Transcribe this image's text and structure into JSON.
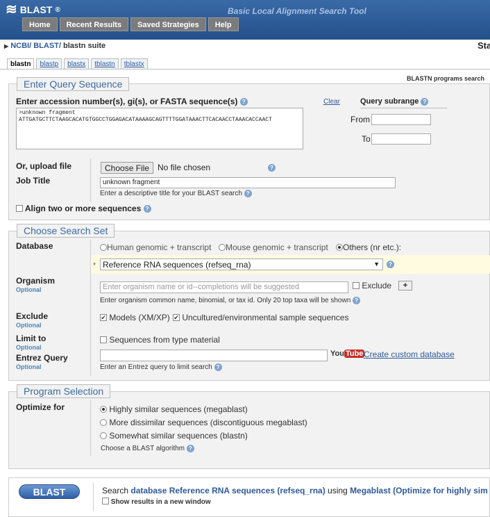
{
  "header": {
    "logo": "BLAST",
    "reg": "®",
    "tool_name": "Basic Local Alignment Search Tool",
    "nav": [
      "Home",
      "Recent Results",
      "Saved Strategies",
      "Help"
    ]
  },
  "breadcrumb": {
    "ncbi": "NCBI/",
    "blast": "BLAST/",
    "current": "blastn suite",
    "right": "Sta"
  },
  "tabs": [
    "blastn",
    "blastp",
    "blastx",
    "tblastn",
    "tblastx"
  ],
  "programs_search": "BLASTN programs search",
  "query": {
    "legend": "Enter Query Sequence",
    "accession_label": "Enter accession number(s), gi(s), or FASTA sequence(s)",
    "clear": "Clear",
    "subrange_title": "Query subrange",
    "from": "From",
    "to": "To",
    "seq_line1": ">unknown fragment",
    "seq_line2": "ATTGATGCTTCTAAGCACATGTGGCCTGGAGACATAAAAGCAGTTTTGGATAAACTTCACAACCTAAACACCAACT",
    "upload_label": "Or, upload file",
    "choose_file": "Choose File",
    "no_file": "No file chosen",
    "job_title_label": "Job Title",
    "job_title_value": "unknown fragment",
    "job_hint": "Enter a descriptive title for your BLAST search",
    "align_two": "Align two or more sequences"
  },
  "search_set": {
    "legend": "Choose Search Set",
    "database_label": "Database",
    "db_options": [
      "Human genomic + transcript",
      "Mouse genomic + transcript",
      "Others (nr etc.):"
    ],
    "db_selected": "Reference RNA sequences (refseq_rna)",
    "organism_label": "Organism",
    "optional": "Optional",
    "organism_placeholder": "Enter organism name or id--completions will be suggested",
    "exclude": "Exclude",
    "plus": "+",
    "organism_hint": "Enter organism common name, binomial, or tax id. Only 20 top taxa will be shown",
    "exclude_label": "Exclude",
    "models": "Models (XM/XP)",
    "uncultured": "Uncultured/environmental sample sequences",
    "limit_label": "Limit to",
    "type_material": "Sequences from type material",
    "entrez_label": "Entrez Query",
    "youtube": "YouTube",
    "custom_db": "Create custom database",
    "entrez_hint": "Enter an Entrez query to limit search"
  },
  "program": {
    "legend": "Program Selection",
    "optimize_label": "Optimize for",
    "options": [
      "Highly similar sequences (megablast)",
      "More dissimilar sequences (discontiguous megablast)",
      "Somewhat similar sequences (blastn)"
    ],
    "choose_hint": "Choose a BLAST algorithm"
  },
  "footer": {
    "blast_button": "BLAST",
    "search_prefix": "Search ",
    "search_db": "database Reference RNA sequences (refseq_rna)",
    "using": " using ",
    "using_prog": "Megablast (Optimize for highly sim",
    "new_window": "Show results in a new window"
  },
  "colors": {
    "header": "#2d5c96",
    "legend_text": "#3d6aa0",
    "link": "#2e5a9a",
    "highlight": "#fffbe0"
  }
}
